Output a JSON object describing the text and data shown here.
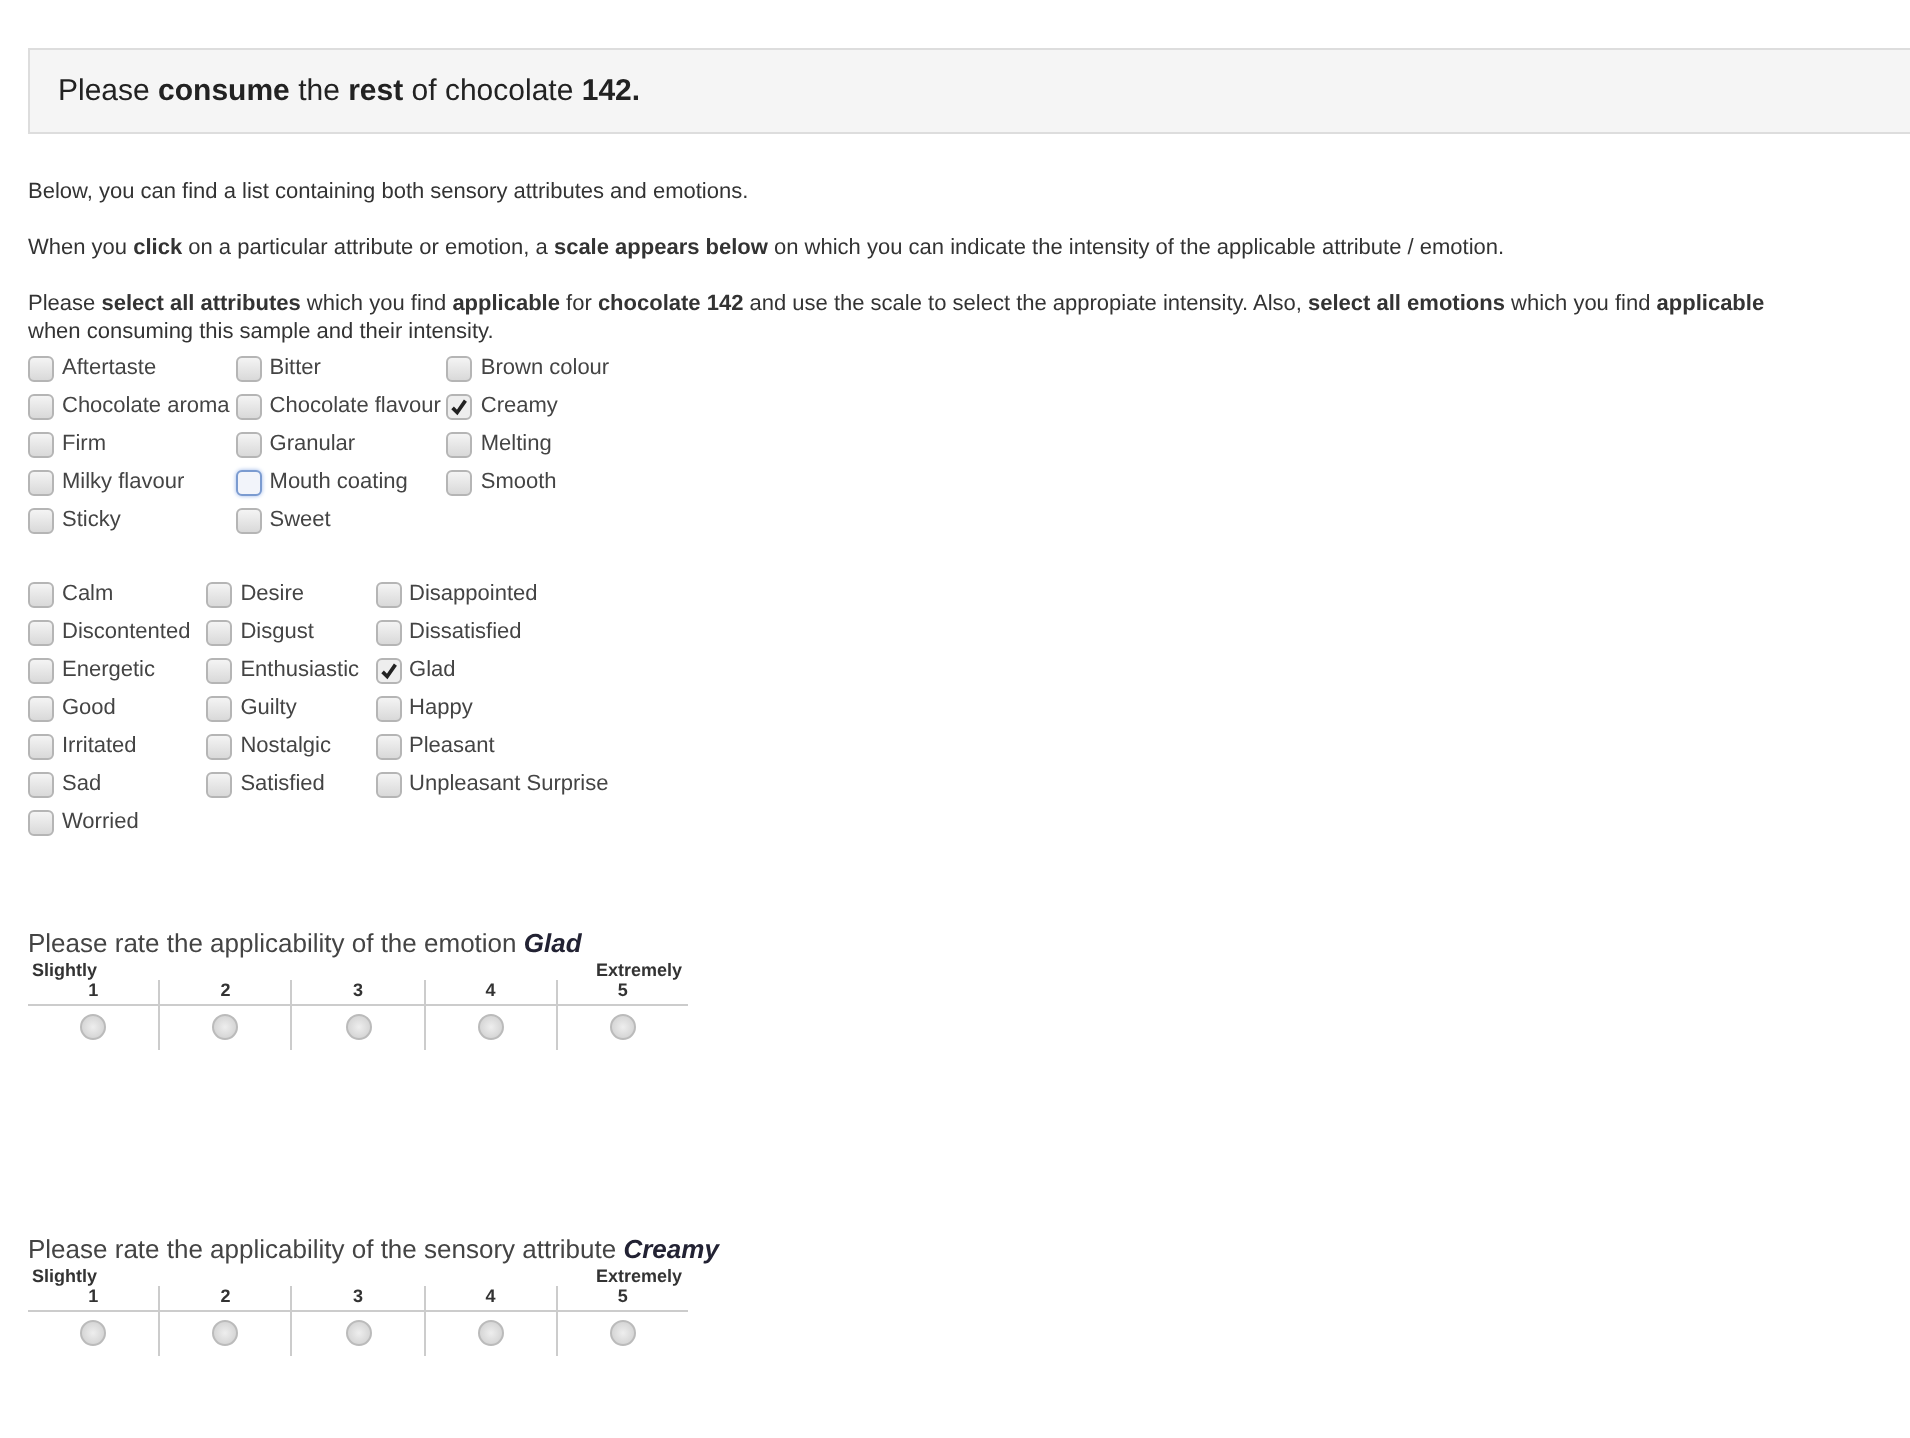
{
  "header": "Please **consume** the **rest** of chocolate **142.**",
  "paragraphs": [
    "Below, you can find a list containing both sensory attributes and emotions.",
    "When you **click** on a particular attribute or emotion, a **scale appears below** on which you can indicate the intensity of the applicable attribute / emotion.",
    "Please **select all attributes** which you find **applicable** for **chocolate 142** and use the scale to select the appropiate intensity.  Also, **select all emotions** which you find **applicable** when consuming this sample and their intensity."
  ],
  "attributes": [
    {
      "label": "Aftertaste",
      "checked": false,
      "focused": false
    },
    {
      "label": "Bitter",
      "checked": false,
      "focused": false
    },
    {
      "label": "Brown colour",
      "checked": false,
      "focused": false
    },
    {
      "label": "Chocolate aroma",
      "checked": false,
      "focused": false
    },
    {
      "label": "Chocolate flavour",
      "checked": false,
      "focused": false
    },
    {
      "label": "Creamy",
      "checked": true,
      "focused": false
    },
    {
      "label": "Firm",
      "checked": false,
      "focused": false
    },
    {
      "label": "Granular",
      "checked": false,
      "focused": false
    },
    {
      "label": "Melting",
      "checked": false,
      "focused": false
    },
    {
      "label": "Milky flavour",
      "checked": false,
      "focused": false
    },
    {
      "label": "Mouth coating",
      "checked": false,
      "focused": true
    },
    {
      "label": "Smooth",
      "checked": false,
      "focused": false
    },
    {
      "label": "Sticky",
      "checked": false,
      "focused": false
    },
    {
      "label": "Sweet",
      "checked": false,
      "focused": false
    }
  ],
  "emotions": [
    {
      "label": "Calm",
      "checked": false
    },
    {
      "label": "Desire",
      "checked": false
    },
    {
      "label": "Disappointed",
      "checked": false
    },
    {
      "label": "Discontented",
      "checked": false
    },
    {
      "label": "Disgust",
      "checked": false
    },
    {
      "label": "Dissatisfied",
      "checked": false
    },
    {
      "label": "Energetic",
      "checked": false
    },
    {
      "label": "Enthusiastic",
      "checked": false
    },
    {
      "label": "Glad",
      "checked": true
    },
    {
      "label": "Good",
      "checked": false
    },
    {
      "label": "Guilty",
      "checked": false
    },
    {
      "label": "Happy",
      "checked": false
    },
    {
      "label": "Irritated",
      "checked": false
    },
    {
      "label": "Nostalgic",
      "checked": false
    },
    {
      "label": "Pleasant",
      "checked": false
    },
    {
      "label": "Sad",
      "checked": false
    },
    {
      "label": "Satisfied",
      "checked": false
    },
    {
      "label": "Unpleasant Surprise",
      "checked": false
    },
    {
      "label": "Worried",
      "checked": false
    }
  ],
  "ratings": [
    {
      "prompt": "Please rate the applicability of the emotion **Glad**",
      "low_label": "Slightly",
      "high_label": "Extremely",
      "options": [
        {
          "label": "1",
          "selected": false
        },
        {
          "label": "2",
          "selected": false
        },
        {
          "label": "3",
          "selected": false
        },
        {
          "label": "4",
          "selected": false
        },
        {
          "label": "5",
          "selected": false
        }
      ]
    },
    {
      "prompt": "Please rate the applicability of the sensory attribute **Creamy**",
      "low_label": "Slightly",
      "high_label": "Extremely",
      "options": [
        {
          "label": "1",
          "selected": false
        },
        {
          "label": "2",
          "selected": false
        },
        {
          "label": "3",
          "selected": false
        },
        {
          "label": "4",
          "selected": false
        },
        {
          "label": "5",
          "selected": false
        }
      ]
    }
  ]
}
